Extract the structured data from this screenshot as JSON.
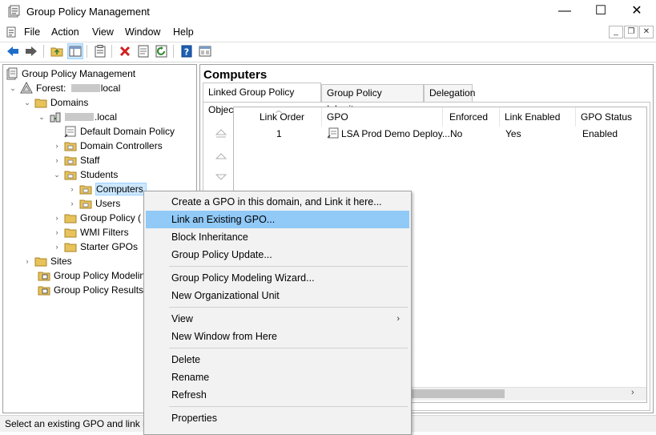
{
  "window": {
    "title": "Group Policy Management",
    "minimize_glyph": "—",
    "maximize_glyph": "☐",
    "close_glyph": "✕"
  },
  "menu": {
    "items": [
      "File",
      "Action",
      "View",
      "Window",
      "Help"
    ],
    "mdi_minimize": "_",
    "mdi_restore": "❐",
    "mdi_close": "✕"
  },
  "toolbar": {
    "buttons": [
      "back-arrow-icon",
      "forward-arrow-icon",
      "up-folder-icon",
      "show-hide-tree-icon",
      "properties-icon",
      "delete-icon",
      "export-icon",
      "refresh-icon",
      "help-icon",
      "console-icon"
    ]
  },
  "tree": {
    "root": "Group Policy Management",
    "forest_prefix": "Forest: ",
    "forest_suffix": "local",
    "domains": "Domains",
    "domain_suffix": ".local",
    "default_policy": "Default Domain Policy",
    "domain_controllers": "Domain Controllers",
    "staff": "Staff",
    "students": "Students",
    "computers": "Computers",
    "users": "Users",
    "group_policy_objects": "Group Policy (",
    "wmi_filters": "WMI Filters",
    "starter_gpos": "Starter GPOs",
    "sites": "Sites",
    "modeling": "Group Policy Modeling",
    "results": "Group Policy Results"
  },
  "right": {
    "title": "Computers",
    "tabs": [
      "Linked Group Policy Objects",
      "Group Policy Inheritance",
      "Delegation"
    ],
    "columns": [
      "Link Order",
      "GPO",
      "Enforced",
      "Link Enabled",
      "GPO Status"
    ],
    "rows": [
      {
        "link_order": "1",
        "gpo": "LSA Prod Demo Deploy...",
        "enforced": "No",
        "link_enabled": "Yes",
        "gpo_status": "Enabled"
      }
    ]
  },
  "context_menu": {
    "items": [
      "Create a GPO in this domain, and Link it here...",
      "Link an Existing GPO...",
      "Block Inheritance",
      "Group Policy Update...",
      "Group Policy Modeling Wizard...",
      "New Organizational Unit",
      "View",
      "New Window from Here",
      "Delete",
      "Rename",
      "Refresh",
      "Properties"
    ],
    "submenu_arrow": "›"
  },
  "status": {
    "text": "Select an existing GPO and link it"
  },
  "colors": {
    "highlight": "#91c9f7",
    "selection": "#cce8ff",
    "folder": "#e8c25a",
    "accent_blue": "#1e6ec8",
    "delete_red": "#d02020"
  }
}
